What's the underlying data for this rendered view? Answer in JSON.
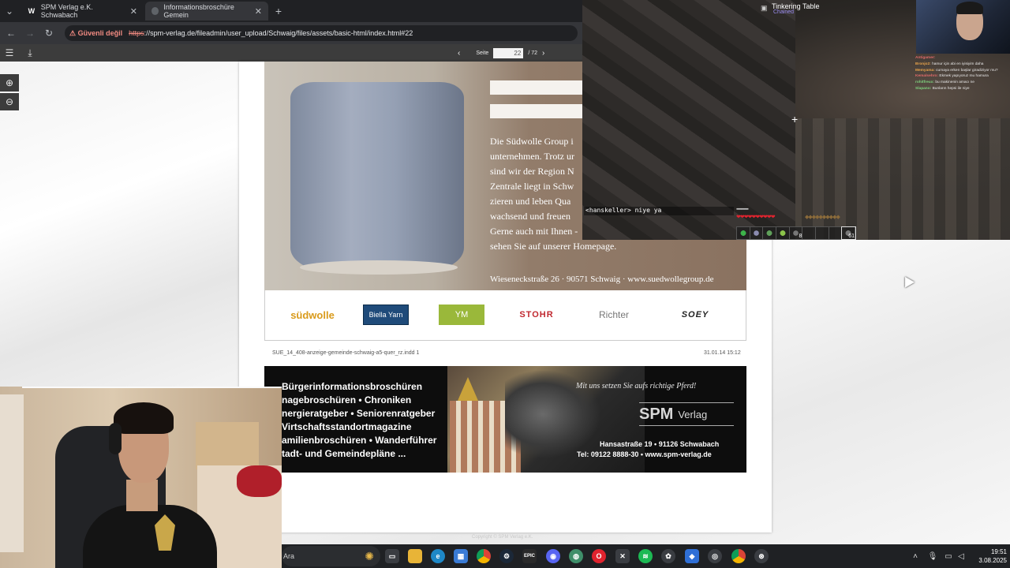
{
  "browser": {
    "tabs": [
      {
        "label": "SPM Verlag e.K. Schwabach",
        "favicon": "W",
        "active": false
      },
      {
        "label": "Informationsbroschüre Gemein",
        "favicon": "",
        "active": true
      }
    ],
    "new_tab_label": "+",
    "security_label": "Güvenli değil",
    "url_scheme": "https",
    "url_rest": "://spm-verlag.de/fileadmin/user_upload/Schwaig/files/assets/basic-html/index.html#22"
  },
  "viewer": {
    "page_label": "Seite",
    "page_value": "22",
    "page_total": "/ 72"
  },
  "ad": {
    "text_lines": [
      "Die Südwolle Group i",
      "unternehmen. Trotz ur",
      "sind wir der Region N",
      "Zentrale liegt in Schw",
      "zieren und leben Qua",
      "wachsend und freuen",
      "Gerne auch mit Ihnen -",
      "sehen Sie auf unserer Homepage."
    ],
    "address": "Wieseneckstraße 26 · 90571 Schwaig · www.suedwollegroup.de",
    "logos": [
      "südwolle",
      "Biella Yarn",
      "YM",
      "STOHR",
      "Richter",
      "SOEY"
    ],
    "file_info": "SUE_14_408-anzeige-gemeinde-schwaig-a5-quer_rz.indd 1",
    "file_date": "31.01.14 15:12"
  },
  "spm": {
    "lines": [
      "Bürgerinformationsbroschüren",
      "nagebroschüren • Chroniken",
      "nergieratgeber • Seniorenratgeber",
      "Virtschaftsstandortmagazine",
      "amilienbroschüren • Wanderführer",
      "tadt- und Gemeindepläne ..."
    ],
    "slogan": "Mit uns setzen Sie aufs richtige Pferd!",
    "logo_big": "SPM",
    "logo_small": "Verlag",
    "address1": "Hansastraße 19 • 91126 Schwabach",
    "address2": "Tel: 09122 8888-30 • www.spm-verlag.de",
    "copyright": "Copyright © SPM Verlag e.K."
  },
  "game": {
    "window_title": "Tinkering Table",
    "subtitle": "Chained",
    "chat_message": "<hanskeller> niye ya",
    "hearts": "❤❤❤❤❤❤❤❤❤❤",
    "armor": "▪▪▪▪▪▪▪▪▪▪",
    "hunger": "◆◆◆◆◆◆◆◆◆◆",
    "hotbar": [
      "",
      "",
      "",
      "",
      "8",
      "",
      "",
      "",
      "61"
    ],
    "crosshair": "+"
  },
  "stream_chat": [
    {
      "user": "Antigamer:",
      "text": ""
    },
    {
      "user": "Bronjo2:",
      "text": "hamur için abi en iyisiyim daha"
    },
    {
      "user": "Memyama:",
      "text": "cumaya erken başlar giradiziyor mu?"
    },
    {
      "user": "Kemalsehro:",
      "text": "Ekmek yapıyoruz mu hamura"
    },
    {
      "user": "rohitfreux:",
      "text": "bu makinenin amacı ne"
    },
    {
      "user": "Slapano:",
      "text": "Bunların hepsi ile niye"
    }
  ],
  "taskbar": {
    "search_label": "Ara",
    "time": "19:51",
    "date": "3.08.2025",
    "apps": [
      "task-view",
      "file-explorer",
      "edge",
      "store",
      "chrome",
      "steam",
      "epic",
      "discord",
      "app",
      "opera",
      "xbox",
      "spotify",
      "chatgpt",
      "vpn",
      "app2",
      "chrome2",
      "settings"
    ]
  }
}
